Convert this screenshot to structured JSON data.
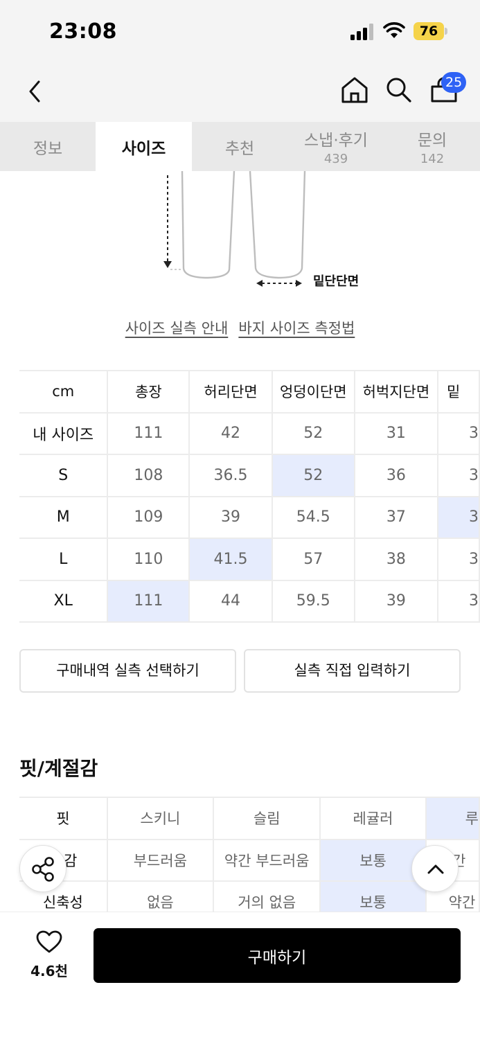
{
  "status_bar": {
    "time": "23:08",
    "battery": "76"
  },
  "nav": {
    "cart_count": "25"
  },
  "tabs": [
    {
      "label": "정보",
      "count": ""
    },
    {
      "label": "사이즈",
      "count": ""
    },
    {
      "label": "추천",
      "count": ""
    },
    {
      "label": "스냅·후기",
      "count": "439"
    },
    {
      "label": "문의",
      "count": "142"
    }
  ],
  "diagram": {
    "hem_label": "밑단단면"
  },
  "guide_links": {
    "size_guide": "사이즈 실측 안내",
    "pants_measure": "바지 사이즈 측정법"
  },
  "size_table": {
    "headers": [
      "cm",
      "총장",
      "허리단면",
      "엉덩이단면",
      "허벅지단면",
      "밑"
    ],
    "rows": [
      {
        "label": "내 사이즈",
        "values": [
          "111",
          "42",
          "52",
          "31",
          "3"
        ]
      },
      {
        "label": "S",
        "values": [
          "108",
          "36.5",
          "52",
          "36",
          "3"
        ]
      },
      {
        "label": "M",
        "values": [
          "109",
          "39",
          "54.5",
          "37",
          "3"
        ]
      },
      {
        "label": "L",
        "values": [
          "110",
          "41.5",
          "57",
          "38",
          "3"
        ]
      },
      {
        "label": "XL",
        "values": [
          "111",
          "44",
          "59.5",
          "39",
          "3"
        ]
      }
    ]
  },
  "actions": {
    "purchase_history": "구매내역 실측 선택하기",
    "manual_input": "실측 직접 입력하기"
  },
  "fit_section": {
    "title": "핏/계절감",
    "rows": [
      {
        "label": "핏",
        "options": [
          "스키니",
          "슬림",
          "레귤러",
          "루"
        ]
      },
      {
        "label": "감",
        "options": [
          "부드러움",
          "약간 부드러움",
          "보통",
          "약간"
        ]
      },
      {
        "label": "신축성",
        "options": [
          "없음",
          "거의 없음",
          "보통",
          "약간"
        ]
      }
    ]
  },
  "bottom": {
    "like_count": "4.6천",
    "buy_label": "구매하기"
  },
  "colors": {
    "highlight": "#e6ecfd",
    "badge": "#2e62f5",
    "battery": "#f5d34a"
  }
}
